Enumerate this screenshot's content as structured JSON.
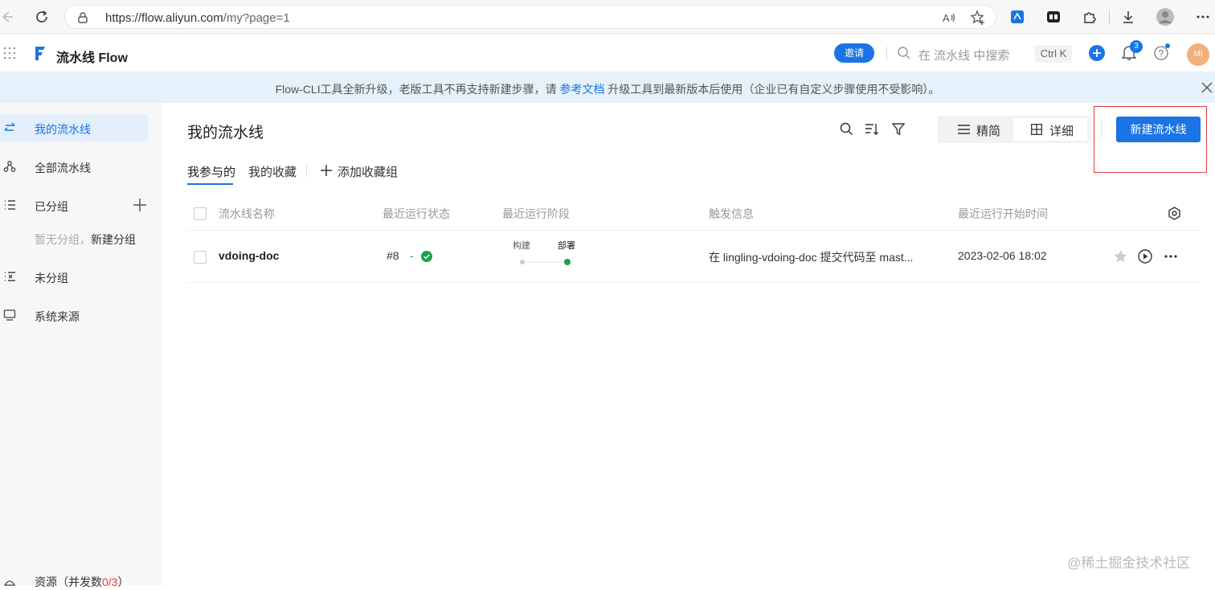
{
  "browser": {
    "url_main": "https://flow.aliyun.com",
    "url_path": "/my?page=1"
  },
  "header": {
    "product_name": "流水线 Flow",
    "invite_label": "邀请",
    "search_placeholder": "在 流水线 中搜索",
    "shortcut": "Ctrl K",
    "notification_count": "3",
    "avatar_initials": "MI"
  },
  "notice": {
    "text_before": "Flow-CLI工具全新升级，老版工具不再支持新建步骤，请 ",
    "link_text": "参考文档",
    "text_after": " 升级工具到最新版本后使用（企业已有自定义步骤使用不受影响）。"
  },
  "sidebar": {
    "items": [
      {
        "label": "我的流水线",
        "icon": "swap-icon"
      },
      {
        "label": "全部流水线",
        "icon": "nodes-icon"
      },
      {
        "label": "已分组",
        "icon": "list-icon"
      },
      {
        "label": "未分组",
        "icon": "ungrouped-list-icon"
      },
      {
        "label": "系统来源",
        "icon": "monitor-icon"
      }
    ],
    "empty_group_text": "暂无分组，",
    "new_group_link": "新建分组",
    "resources_label": "资源（并发数",
    "resources_value": "0/3",
    "resources_close": "）"
  },
  "main": {
    "title": "我的流水线",
    "view_simple": "精简",
    "view_detail": "详细",
    "new_pipeline_button": "新建流水线",
    "tabs": [
      "我参与的",
      "我的收藏"
    ],
    "add_favorite_group": "添加收藏组",
    "columns": [
      "流水线名称",
      "最近运行状态",
      "最近运行阶段",
      "触发信息",
      "最近运行开始时间"
    ],
    "rows": [
      {
        "name": "vdoing-doc",
        "run_number": "#8",
        "status_dash": "-",
        "stages": [
          "构建",
          "部署"
        ],
        "trigger": "在 lingling-vdoing-doc 提交代码至 mast...",
        "start_time": "2023-02-06 18:02"
      }
    ]
  },
  "colors": {
    "primary": "#1b74e4",
    "success": "#17a34a",
    "highlight_box": "#e03c3c",
    "notice_bg": "#e5f1fb"
  },
  "watermark": "@稀土掘金技术社区"
}
